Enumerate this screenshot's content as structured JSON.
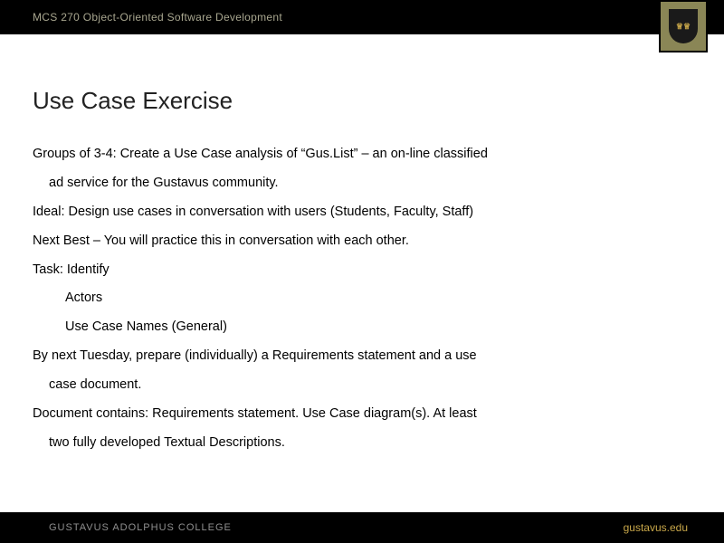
{
  "header": {
    "course": "MCS 270 Object-Oriented Software Development"
  },
  "slide": {
    "title": "Use Case Exercise",
    "lines": [
      {
        "text": "Groups of 3-4: Create a Use Case analysis of “Gus.List” – an on-line classified",
        "indent": 0
      },
      {
        "text": "ad service for the Gustavus community.",
        "indent": 1
      },
      {
        "text": "Ideal: Design use cases in conversation with users (Students, Faculty, Staff)",
        "indent": 0
      },
      {
        "text": "Next Best – You will practice this in conversation with each other.",
        "indent": 0
      },
      {
        "text": "Task: Identify",
        "indent": 0
      },
      {
        "text": "Actors",
        "indent": 2
      },
      {
        "text": "Use Case Names (General)",
        "indent": 2
      },
      {
        "text": "By next Tuesday, prepare (individually) a Requirements statement and a use",
        "indent": 0
      },
      {
        "text": "case document.",
        "indent": 1
      },
      {
        "text": "Document contains: Requirements statement. Use Case diagram(s). At least",
        "indent": 0
      },
      {
        "text": "two fully developed Textual Descriptions.",
        "indent": 1
      }
    ]
  },
  "footer": {
    "college": "GUSTAVUS ADOLPHUS COLLEGE",
    "url": "gustavus.edu"
  },
  "logo": {
    "crest_text": "♕♕"
  }
}
